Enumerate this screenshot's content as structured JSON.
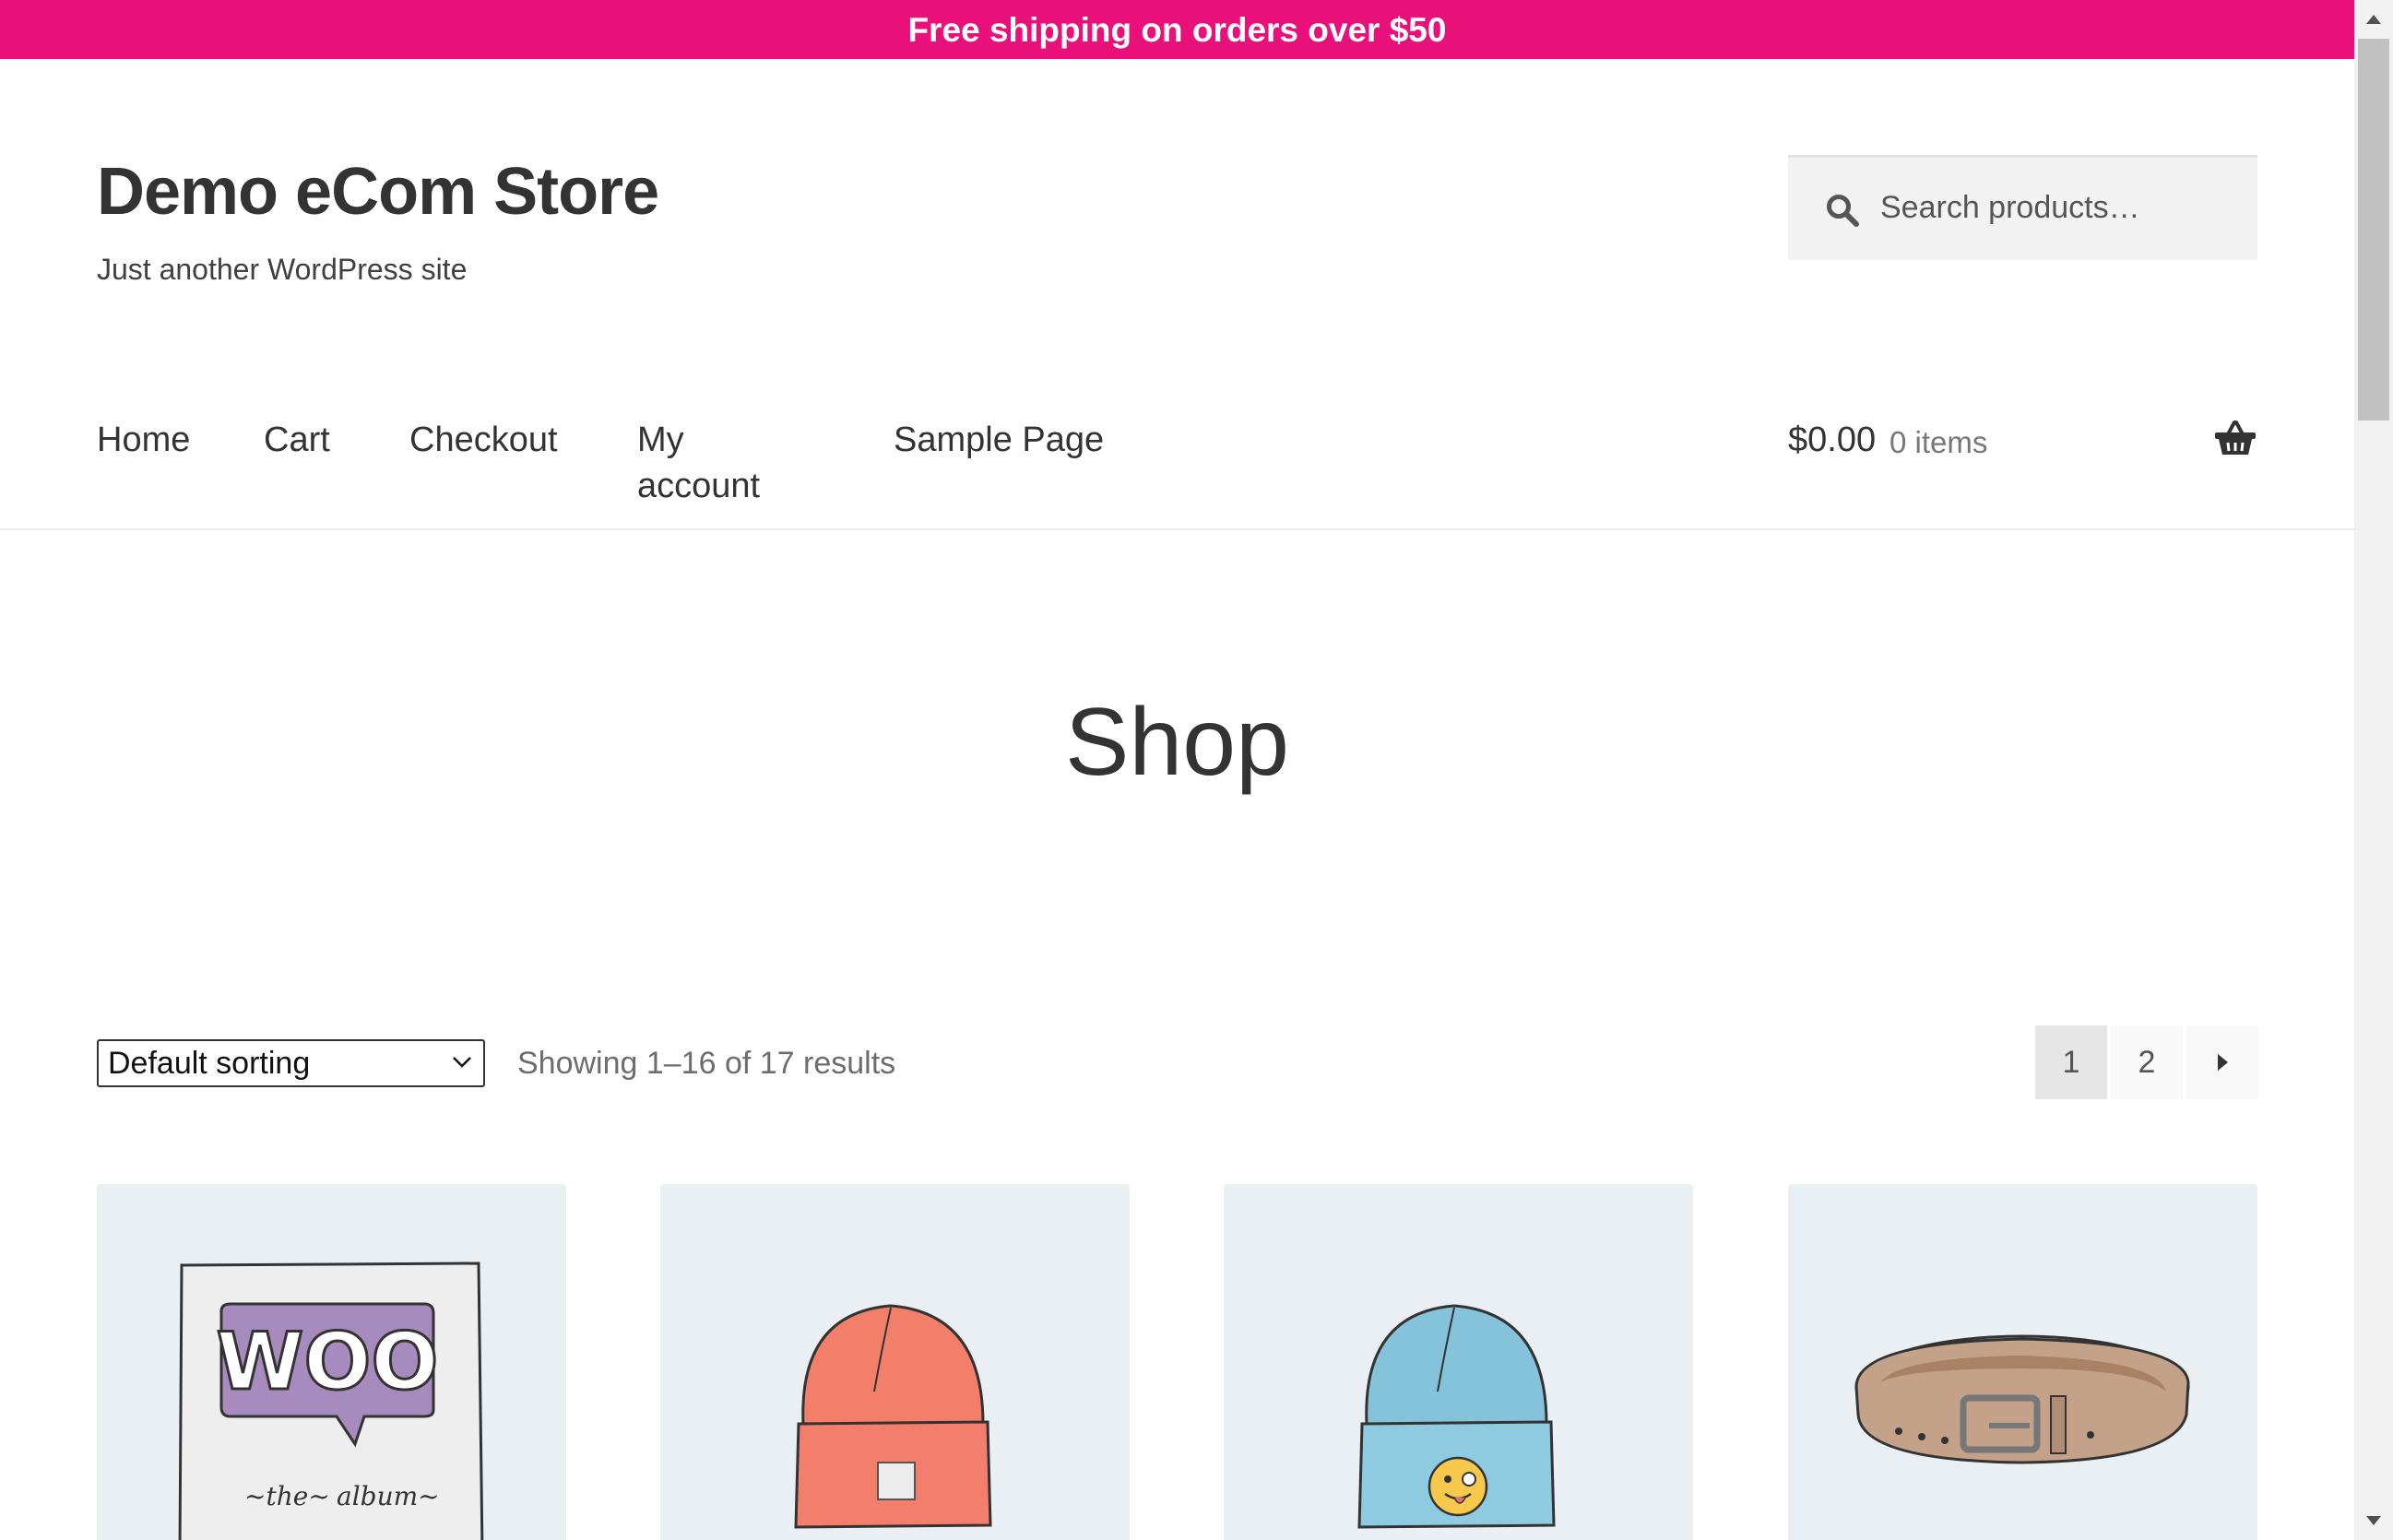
{
  "banner": {
    "text": "Free shipping on orders over $50",
    "color": "#e9107a"
  },
  "site": {
    "title": "Demo eCom Store",
    "tagline": "Just another WordPress site"
  },
  "search": {
    "placeholder": "Search products…",
    "icon": "search-icon"
  },
  "nav": {
    "items": [
      {
        "label": "Home"
      },
      {
        "label": "Cart"
      },
      {
        "label": "Checkout"
      },
      {
        "label": "My account"
      },
      {
        "label": "Sample Page"
      }
    ]
  },
  "cart": {
    "total": "$0.00",
    "count": "0 items",
    "icon": "basket-icon"
  },
  "page": {
    "title": "Shop"
  },
  "toolbar": {
    "sort": {
      "selected": "Default sorting"
    },
    "result_count": "Showing 1–16 of 17 results",
    "pagination": {
      "pages": [
        "1",
        "2"
      ],
      "current": "1",
      "next_icon": "arrow-right-icon"
    }
  },
  "products": [
    {
      "image": "album-cover-image"
    },
    {
      "image": "orange-beanie-image"
    },
    {
      "image": "blue-beanie-with-logo-image"
    },
    {
      "image": "brown-belt-image"
    }
  ],
  "colors": {
    "accent": "#e9107a",
    "text": "#333333",
    "product_bg": "#eaeff3"
  }
}
